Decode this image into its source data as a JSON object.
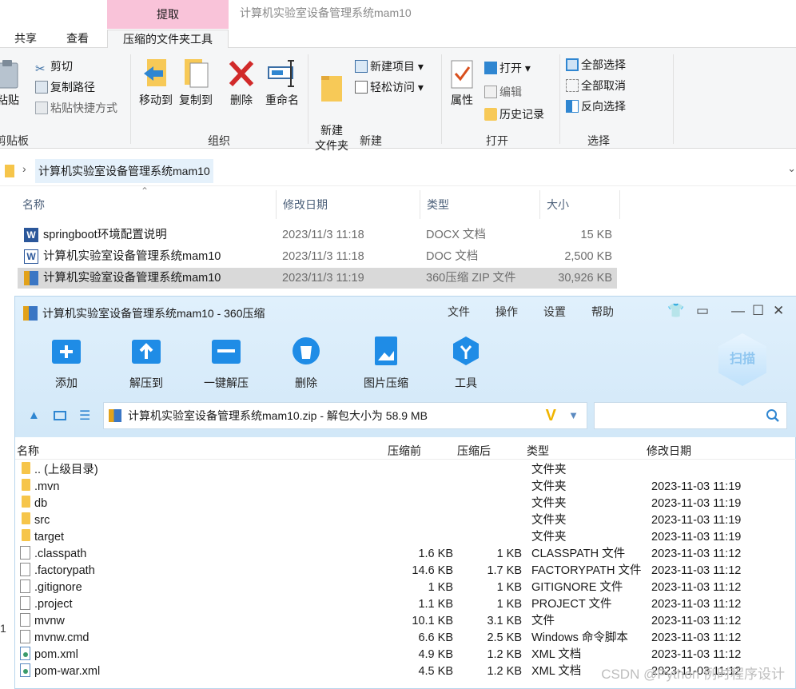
{
  "explorer": {
    "context_tab": "提取",
    "window_title": "计算机实验室设备管理系统mam10",
    "tabs": [
      "共享",
      "查看",
      "压缩的文件夹工具"
    ],
    "ribbon": {
      "clipboard": {
        "paste": "粘贴",
        "cut": "剪切",
        "copy_path": "复制路径",
        "paste_shortcut": "粘贴快捷方式",
        "label": "剪贴板"
      },
      "organize": {
        "move_to": "移动到",
        "copy_to": "复制到",
        "delete": "删除",
        "rename": "重命名",
        "label": "组织"
      },
      "new": {
        "new_folder": "新建\n文件夹",
        "new_item": "新建项目",
        "easy_access": "轻松访问",
        "label": "新建"
      },
      "open": {
        "properties": "属性",
        "open": "打开",
        "edit": "编辑",
        "history": "历史记录",
        "label": "打开"
      },
      "select": {
        "select_all": "全部选择",
        "select_none": "全部取消",
        "invert": "反向选择",
        "label": "选择"
      }
    },
    "address": "计算机实验室设备管理系统mam10",
    "columns": [
      "名称",
      "修改日期",
      "类型",
      "大小"
    ],
    "files": [
      {
        "name": "springboot环境配置说明",
        "date": "2023/11/3 11:18",
        "type": "DOCX 文档",
        "size": "15 KB",
        "icon": "word-icon"
      },
      {
        "name": "计算机实验室设备管理系统mam10",
        "date": "2023/11/3 11:18",
        "type": "DOC 文档",
        "size": "2,500 KB",
        "icon": "word-outline-icon"
      },
      {
        "name": "计算机实验室设备管理系统mam10",
        "date": "2023/11/3 11:19",
        "type": "360压缩 ZIP 文件",
        "size": "30,926 KB",
        "icon": "zip-icon"
      }
    ],
    "status_partial": "1"
  },
  "zip": {
    "title": "计算机实验室设备管理系统mam10 - 360压缩",
    "menu": [
      "文件",
      "操作",
      "设置",
      "帮助"
    ],
    "tools": [
      "添加",
      "解压到",
      "一键解压",
      "删除",
      "图片压缩",
      "工具"
    ],
    "scan": "扫描",
    "path": "计算机实验室设备管理系统mam10.zip - 解包大小为 58.9 MB",
    "columns": [
      "名称",
      "压缩前",
      "压缩后",
      "类型",
      "修改日期"
    ],
    "rows": [
      {
        "name": ".. (上级目录)",
        "before": "",
        "after": "",
        "type": "文件夹",
        "date": "",
        "kind": "folder"
      },
      {
        "name": ".mvn",
        "before": "",
        "after": "",
        "type": "文件夹",
        "date": "2023-11-03 11:19",
        "kind": "folder"
      },
      {
        "name": "db",
        "before": "",
        "after": "",
        "type": "文件夹",
        "date": "2023-11-03 11:19",
        "kind": "folder"
      },
      {
        "name": "src",
        "before": "",
        "after": "",
        "type": "文件夹",
        "date": "2023-11-03 11:19",
        "kind": "folder"
      },
      {
        "name": "target",
        "before": "",
        "after": "",
        "type": "文件夹",
        "date": "2023-11-03 11:19",
        "kind": "folder"
      },
      {
        "name": ".classpath",
        "before": "1.6 KB",
        "after": "1 KB",
        "type": "CLASSPATH 文件",
        "date": "2023-11-03 11:12",
        "kind": "file"
      },
      {
        "name": ".factorypath",
        "before": "14.6 KB",
        "after": "1.7 KB",
        "type": "FACTORYPATH 文件",
        "date": "2023-11-03 11:12",
        "kind": "file"
      },
      {
        "name": ".gitignore",
        "before": "1 KB",
        "after": "1 KB",
        "type": "GITIGNORE 文件",
        "date": "2023-11-03 11:12",
        "kind": "file"
      },
      {
        "name": ".project",
        "before": "1.1 KB",
        "after": "1 KB",
        "type": "PROJECT 文件",
        "date": "2023-11-03 11:12",
        "kind": "file"
      },
      {
        "name": "mvnw",
        "before": "10.1 KB",
        "after": "3.1 KB",
        "type": "文件",
        "date": "2023-11-03 11:12",
        "kind": "file"
      },
      {
        "name": "mvnw.cmd",
        "before": "6.6 KB",
        "after": "2.5 KB",
        "type": "Windows 命令脚本",
        "date": "2023-11-03 11:12",
        "kind": "file"
      },
      {
        "name": "pom.xml",
        "before": "4.9 KB",
        "after": "1.2 KB",
        "type": "XML 文档",
        "date": "2023-11-03 11:12",
        "kind": "xml"
      },
      {
        "name": "pom-war.xml",
        "before": "4.5 KB",
        "after": "1.2 KB",
        "type": "XML 文档",
        "date": "2023-11-03 11:12",
        "kind": "xml"
      }
    ]
  },
  "watermark": "CSDN @Python 例时程序设计"
}
